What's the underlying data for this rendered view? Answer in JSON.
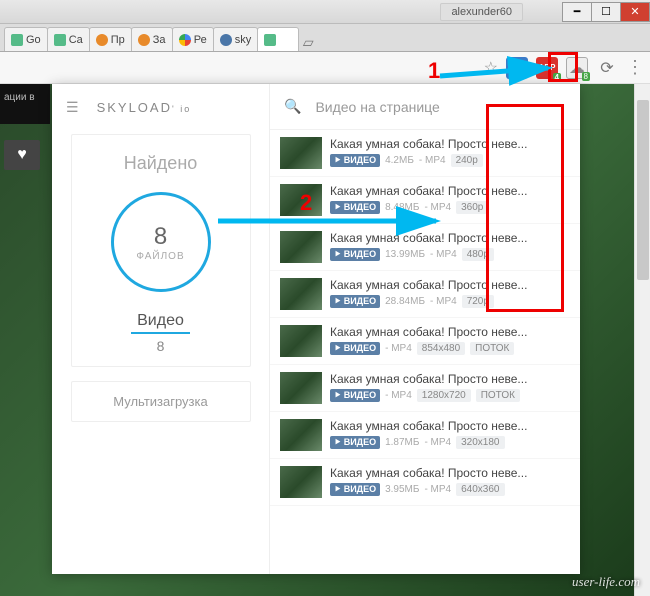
{
  "titlebar": {
    "user": "alexunder60"
  },
  "tabs": [
    "Go",
    "Ca",
    "Пр",
    "За",
    "Ре",
    "sky",
    ""
  ],
  "toolbar": {
    "abp": "ABP",
    "abp_badge": "4",
    "cloud_badge": "8"
  },
  "annotations": {
    "n1": "1",
    "n2": "2"
  },
  "popup": {
    "brand": "SKYLOAD",
    "brand_sup": "' io",
    "found": "Найдено",
    "circle_num": "8",
    "circle_label": "ФАЙЛОВ",
    "video_tab": "Видео",
    "video_count": "8",
    "multi": "Мультизагрузка",
    "search_label": "Видео на странице"
  },
  "itemTitleA": "Какая умная собака! Просто неве...",
  "itemTitleB": "Какая умная собака! Просто неве...",
  "vk_label": "ВИДЕО",
  "items": [
    {
      "title": "Какая умная собака! Просто неве...",
      "size": "4.2МБ",
      "fmt": "- MP4",
      "res": "240p",
      "stream": ""
    },
    {
      "title": "Какая умная собака! Просто неве...",
      "size": "8.48МБ",
      "fmt": "- MP4",
      "res": "360p",
      "stream": ""
    },
    {
      "title": "Какая умная собака! Просто неве...",
      "size": "13.99МБ",
      "fmt": "- MP4",
      "res": "480p",
      "stream": ""
    },
    {
      "title": "Какая умная собака! Просто неве...",
      "size": "28.84МБ",
      "fmt": "- MP4",
      "res": "720p",
      "stream": ""
    },
    {
      "title": "Какая умная собака! Просто неве...",
      "size": "",
      "fmt": "- MP4",
      "res": "854x480",
      "stream": "ПОТОК"
    },
    {
      "title": "Какая умная собака! Просто неве...",
      "size": "",
      "fmt": "- MP4",
      "res": "1280x720",
      "stream": "ПОТОК"
    },
    {
      "title": "Какая умная собака! Просто неве...",
      "size": "1.87МБ",
      "fmt": "- MP4",
      "res": "320x180",
      "stream": ""
    },
    {
      "title": "Какая умная собака! Просто неве...",
      "size": "3.95МБ",
      "fmt": "- MP4",
      "res": "640x360",
      "stream": ""
    }
  ],
  "vk_sidebar": "ации в",
  "watermark": "user-life.com"
}
